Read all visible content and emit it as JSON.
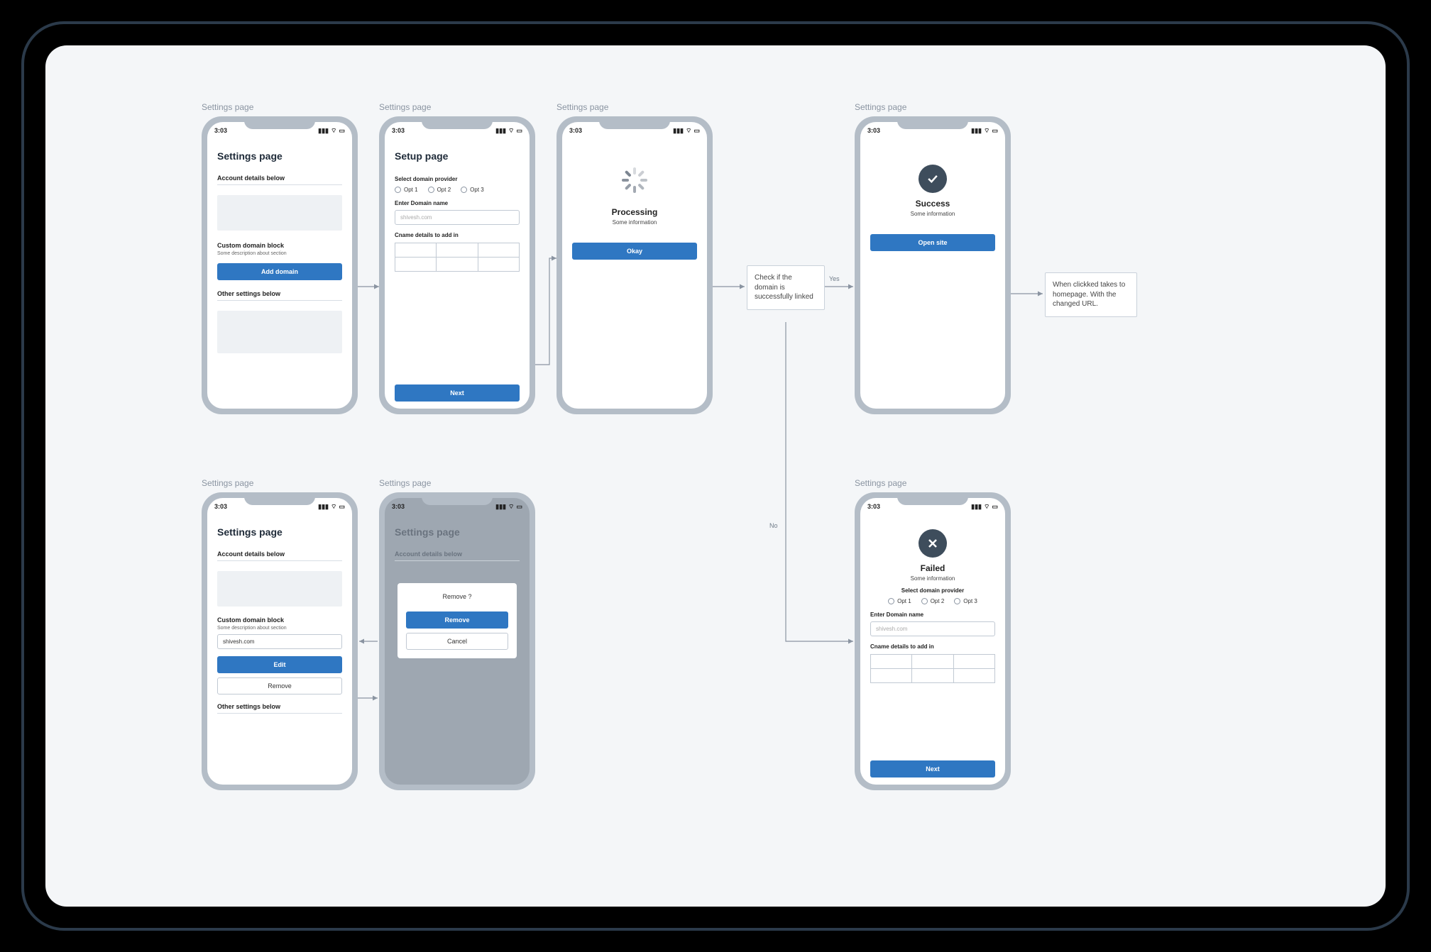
{
  "common": {
    "time": "3:03",
    "frame_label": "Settings page"
  },
  "screen1": {
    "title": "Settings page",
    "account_label": "Account details below",
    "domain_label": "Custom domain block",
    "domain_desc": "Some description about section",
    "add_btn": "Add domain",
    "other_label": "Other settings below"
  },
  "screen2": {
    "title": "Setup page",
    "provider_label": "Select domain provider",
    "opts": [
      "Opt 1",
      "Opt 2",
      "Opt 3"
    ],
    "domain_label": "Enter Domain name",
    "domain_placeholder": "shivesh.com",
    "cname_label": "Cname details to add in",
    "next_btn": "Next"
  },
  "screen3": {
    "title": "Processing",
    "sub": "Some information",
    "okay_btn": "Okay"
  },
  "decision": {
    "text": "Check if the domain is successfully linked",
    "yes": "Yes",
    "no": "No"
  },
  "screen4": {
    "title": "Success",
    "sub": "Some information",
    "open_btn": "Open site"
  },
  "homepage_note": "When clickked takes to homepage. With the changed URL.",
  "screen5": {
    "title": "Settings page",
    "account_label": "Account details below",
    "domain_label": "Custom domain block",
    "domain_desc": "Some description about section",
    "domain_value": "shivesh.com",
    "edit_btn": "Edit",
    "remove_btn": "Remove",
    "other_label": "Other settings below"
  },
  "screen6": {
    "bg_title": "Settings page",
    "bg_account": "Account details below",
    "modal_title": "Remove ?",
    "remove_btn": "Remove",
    "cancel_btn": "Cancel"
  },
  "screen7": {
    "title": "Failed",
    "sub": "Some information",
    "provider_label": "Select domain provider",
    "opts": [
      "Opt 1",
      "Opt 2",
      "Opt 3"
    ],
    "domain_label": "Enter Domain name",
    "domain_placeholder": "shivesh.com",
    "cname_label": "Cname details to add in",
    "next_btn": "Next"
  }
}
